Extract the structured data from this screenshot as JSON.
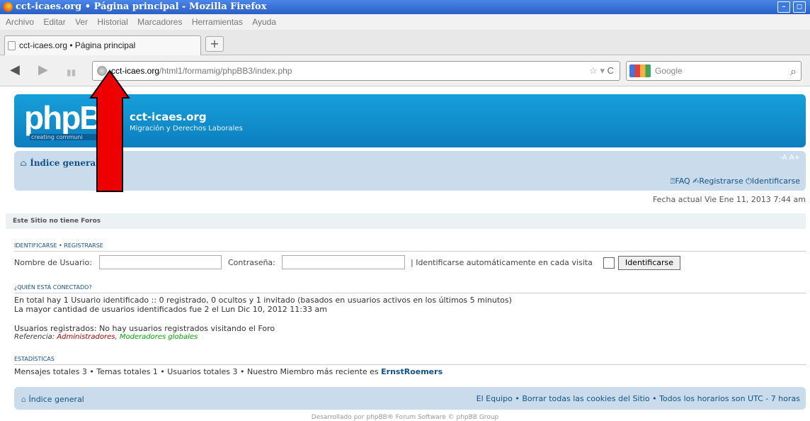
{
  "browser": {
    "title": "cct-icaes.org • Página principal - Mozilla Firefox",
    "menu": [
      "Archivo",
      "Editar",
      "Ver",
      "Historial",
      "Marcadores",
      "Herramientas",
      "Ayuda"
    ],
    "tab_label": "cct-icaes.org • Página principal",
    "url_domain": "cct-icaes.org",
    "url_path": "/html1/formamig/phpBB3/index.php",
    "search_placeholder": "Google"
  },
  "site": {
    "logo_text": "phpB",
    "logo_sub": "creating communi",
    "title": "cct-icaes.org",
    "description": "Migración y Derechos Laborales",
    "nav_index": "Índice general",
    "accessibility": "-A A+",
    "faq": "FAQ",
    "register": "Registrarse",
    "login": "Identificarse",
    "date": "Fecha actual Vie Ene 11, 2013 7:44 am",
    "no_forums": "Este Sitio no tiene Foros"
  },
  "login_section": {
    "header": "IDENTIFICARSE • REGISTRARSE",
    "username_label": "Nombre de Usuario:",
    "password_label": "Contraseña:",
    "auto_label": "| Identificarse automáticamente en cada visita",
    "button": "Identificarse"
  },
  "online_section": {
    "header": "¿QUIÉN ESTÁ CONECTADO?",
    "line1": "En total hay 1 Usuario identificado :: 0 registrado, 0 ocultos y 1 invitado (basados en usuarios activos en los últimos 5 minutos)",
    "line2": "La mayor cantidad de usuarios identificados fue 2 el Lun Dic 10, 2012 11:33 am",
    "registered": "Usuarios registrados: No hay usuarios registrados visitando el Foro",
    "legend_prefix": "Referencia: ",
    "admins": "Administradores",
    "sep": ", ",
    "mods": "Moderadores globales"
  },
  "stats_section": {
    "header": "ESTADÍSTICAS",
    "line": "Mensajes totales 3 • Temas totales 1 • Usuarios totales 3 • Nuestro Miembro más reciente es ",
    "newest": "ErnstRoemers"
  },
  "footer": {
    "index": "Índice general",
    "links": "El Equipo • Borrar todas las cookies del Sitio • Todos los horarios son UTC - 7 horas",
    "powered": "Desarrollado por phpBB® Forum Software © phpBB Group"
  }
}
